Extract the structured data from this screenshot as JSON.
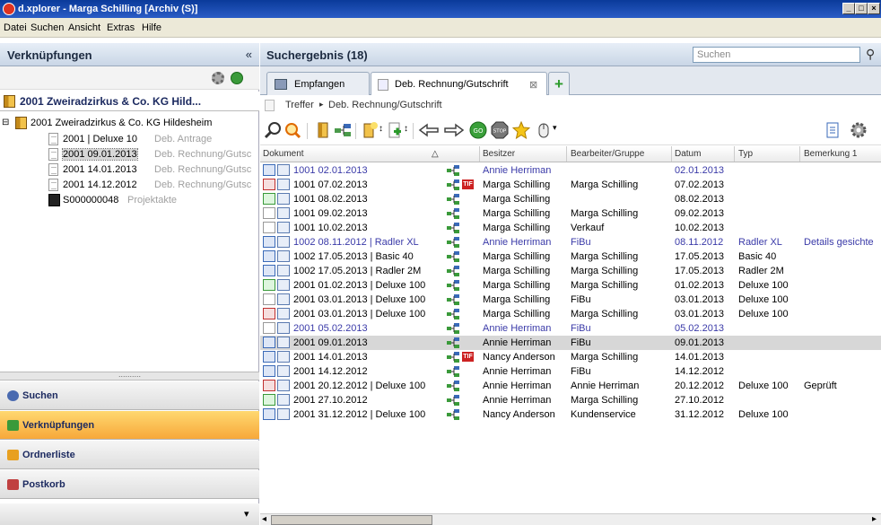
{
  "window": {
    "title": "d.xplorer - Marga Schilling [Archiv (S)]",
    "btn_min": "_",
    "btn_max": "□",
    "btn_close": "×"
  },
  "menu": [
    "Datei",
    "Suchen",
    "Ansicht",
    "Extras",
    "Hilfe"
  ],
  "left": {
    "header": "Verknüpfungen",
    "collapse": "«",
    "root_title": "2001 Zweiradzirkus & Co. KG Hild...",
    "tree_parent": "2001 Zweiradzirkus & Co. KG Hildesheim",
    "tree_parent_toggle": "⊟",
    "tree_children": [
      {
        "text": "2001  | Deluxe 10",
        "grey": "Deb. Antrage",
        "selected": false
      },
      {
        "text": "2001  09.01.2013",
        "grey": "Deb. Rechnung/Gutsc",
        "selected": true
      },
      {
        "text": "2001  14.01.2013",
        "grey": "Deb. Rechnung/Gutsc",
        "selected": false
      },
      {
        "text": "2001  14.12.2012",
        "grey": "Deb. Rechnung/Gutsc",
        "selected": false
      },
      {
        "text": "S000000048",
        "grey": "Projektakte",
        "selected": false
      }
    ],
    "splitter": "..........",
    "nav": [
      {
        "label": "Suchen",
        "icon": "search-icon",
        "active": false
      },
      {
        "label": "Verknüpfungen",
        "icon": "link-icon",
        "active": true
      },
      {
        "label": "Ordnerliste",
        "icon": "folder-icon",
        "active": false
      },
      {
        "label": "Postkorb",
        "icon": "inbox-icon",
        "active": false
      }
    ],
    "nav_more": "▾"
  },
  "right": {
    "header": "Suchergebnis (18)",
    "search_placeholder": "Suchen",
    "tabs": [
      {
        "label": "Empfangen",
        "selected": false
      },
      {
        "label": "Deb. Rechnung/Gutschrift",
        "selected": true
      }
    ],
    "tab_close": "⊠",
    "tab_add": "+",
    "breadcrumb": [
      "Treffer",
      "Deb. Rechnung/Gutschrift"
    ],
    "breadcrumb_sep": "▸",
    "columns": [
      "Dokument",
      "Besitzer",
      "Bearbeiter/Gruppe",
      "Datum",
      "Typ",
      "Bemerkung 1"
    ],
    "sort_indicator": "△",
    "rows": [
      {
        "doc": "1001  02.01.2013",
        "besitzer": "Annie Herriman",
        "bearbeiter": "",
        "datum": "02.01.2013",
        "typ": "",
        "bem": "",
        "blue": true,
        "tif": false,
        "hl": false,
        "icon": "doc-blue"
      },
      {
        "doc": "1001  07.02.2013",
        "besitzer": "Marga Schilling",
        "bearbeiter": "Marga Schilling",
        "datum": "07.02.2013",
        "typ": "",
        "bem": "",
        "blue": false,
        "tif": true,
        "hl": false,
        "icon": "doc-red"
      },
      {
        "doc": "1001  08.02.2013",
        "besitzer": "Marga Schilling",
        "bearbeiter": "",
        "datum": "08.02.2013",
        "typ": "",
        "bem": "",
        "blue": false,
        "tif": false,
        "hl": false,
        "icon": "doc-green"
      },
      {
        "doc": "1001  09.02.2013",
        "besitzer": "Marga Schilling",
        "bearbeiter": "Marga Schilling",
        "datum": "09.02.2013",
        "typ": "",
        "bem": "",
        "blue": false,
        "tif": false,
        "hl": false,
        "icon": "doc"
      },
      {
        "doc": "1001  10.02.2013",
        "besitzer": "Marga Schilling",
        "bearbeiter": "Verkauf",
        "datum": "10.02.2013",
        "typ": "",
        "bem": "",
        "blue": false,
        "tif": false,
        "hl": false,
        "icon": "doc"
      },
      {
        "doc": "1002  08.11.2012 | Radler XL",
        "besitzer": "Annie Herriman",
        "bearbeiter": "FiBu",
        "datum": "08.11.2012",
        "typ": "Radler XL",
        "bem": "Details gesichte",
        "blue": true,
        "tif": false,
        "hl": false,
        "icon": "doc-blue"
      },
      {
        "doc": "1002  17.05.2013 |  Basic 40",
        "besitzer": "Marga Schilling",
        "bearbeiter": "Marga Schilling",
        "datum": "17.05.2013",
        "typ": "Basic 40",
        "bem": "",
        "blue": false,
        "tif": false,
        "hl": false,
        "icon": "doc-blue"
      },
      {
        "doc": "1002  17.05.2013 | Radler 2M",
        "besitzer": "Marga Schilling",
        "bearbeiter": "Marga Schilling",
        "datum": "17.05.2013",
        "typ": "Radler 2M",
        "bem": "",
        "blue": false,
        "tif": false,
        "hl": false,
        "icon": "doc-blue"
      },
      {
        "doc": "2001  01.02.2013 | Deluxe 100",
        "besitzer": "Marga Schilling",
        "bearbeiter": "Marga Schilling",
        "datum": "01.02.2013",
        "typ": "Deluxe 100",
        "bem": "",
        "blue": false,
        "tif": false,
        "hl": false,
        "icon": "doc-green"
      },
      {
        "doc": "2001  03.01.2013 | Deluxe 100",
        "besitzer": "Marga Schilling",
        "bearbeiter": "FiBu",
        "datum": "03.01.2013",
        "typ": "Deluxe 100",
        "bem": "",
        "blue": false,
        "tif": false,
        "hl": false,
        "icon": "doc"
      },
      {
        "doc": "2001  03.01.2013 | Deluxe 100",
        "besitzer": "Marga Schilling",
        "bearbeiter": "Marga Schilling",
        "datum": "03.01.2013",
        "typ": "Deluxe 100",
        "bem": "",
        "blue": false,
        "tif": false,
        "hl": false,
        "icon": "doc-red"
      },
      {
        "doc": "2001  05.02.2013",
        "besitzer": "Annie Herriman",
        "bearbeiter": "FiBu",
        "datum": "05.02.2013",
        "typ": "",
        "bem": "",
        "blue": true,
        "tif": false,
        "hl": false,
        "icon": "doc"
      },
      {
        "doc": "2001  09.01.2013",
        "besitzer": "Annie Herriman",
        "bearbeiter": "FiBu",
        "datum": "09.01.2013",
        "typ": "",
        "bem": "",
        "blue": false,
        "tif": false,
        "hl": true,
        "icon": "doc-blue"
      },
      {
        "doc": "2001  14.01.2013",
        "besitzer": "Nancy Anderson",
        "bearbeiter": "Marga Schilling",
        "datum": "14.01.2013",
        "typ": "",
        "bem": "",
        "blue": false,
        "tif": true,
        "hl": false,
        "icon": "doc-blue"
      },
      {
        "doc": "2001  14.12.2012",
        "besitzer": "Annie Herriman",
        "bearbeiter": "FiBu",
        "datum": "14.12.2012",
        "typ": "",
        "bem": "",
        "blue": false,
        "tif": false,
        "hl": false,
        "icon": "doc-blue"
      },
      {
        "doc": "2001  20.12.2012 | Deluxe 100",
        "besitzer": "Annie Herriman",
        "bearbeiter": "Annie Herriman",
        "datum": "20.12.2012",
        "typ": "Deluxe 100",
        "bem": "Geprüft",
        "blue": false,
        "tif": false,
        "hl": false,
        "icon": "doc-red"
      },
      {
        "doc": "2001  27.10.2012",
        "besitzer": "Annie Herriman",
        "bearbeiter": "Marga Schilling",
        "datum": "27.10.2012",
        "typ": "",
        "bem": "",
        "blue": false,
        "tif": false,
        "hl": false,
        "icon": "doc-green"
      },
      {
        "doc": "2001  31.12.2012 | Deluxe 100",
        "besitzer": "Nancy Anderson",
        "bearbeiter": "Kundenservice",
        "datum": "31.12.2012",
        "typ": "Deluxe 100",
        "bem": "",
        "blue": false,
        "tif": false,
        "hl": false,
        "icon": "doc-blue"
      }
    ],
    "tif_label": "TIF",
    "scroll_left": "◂",
    "scroll_right": "▸"
  },
  "colors": {
    "titlebar": "#0a3a9a",
    "active_nav": "#f7a83a",
    "link_blue": "#3a3aa8",
    "grey_text": "#a0a0a0"
  }
}
